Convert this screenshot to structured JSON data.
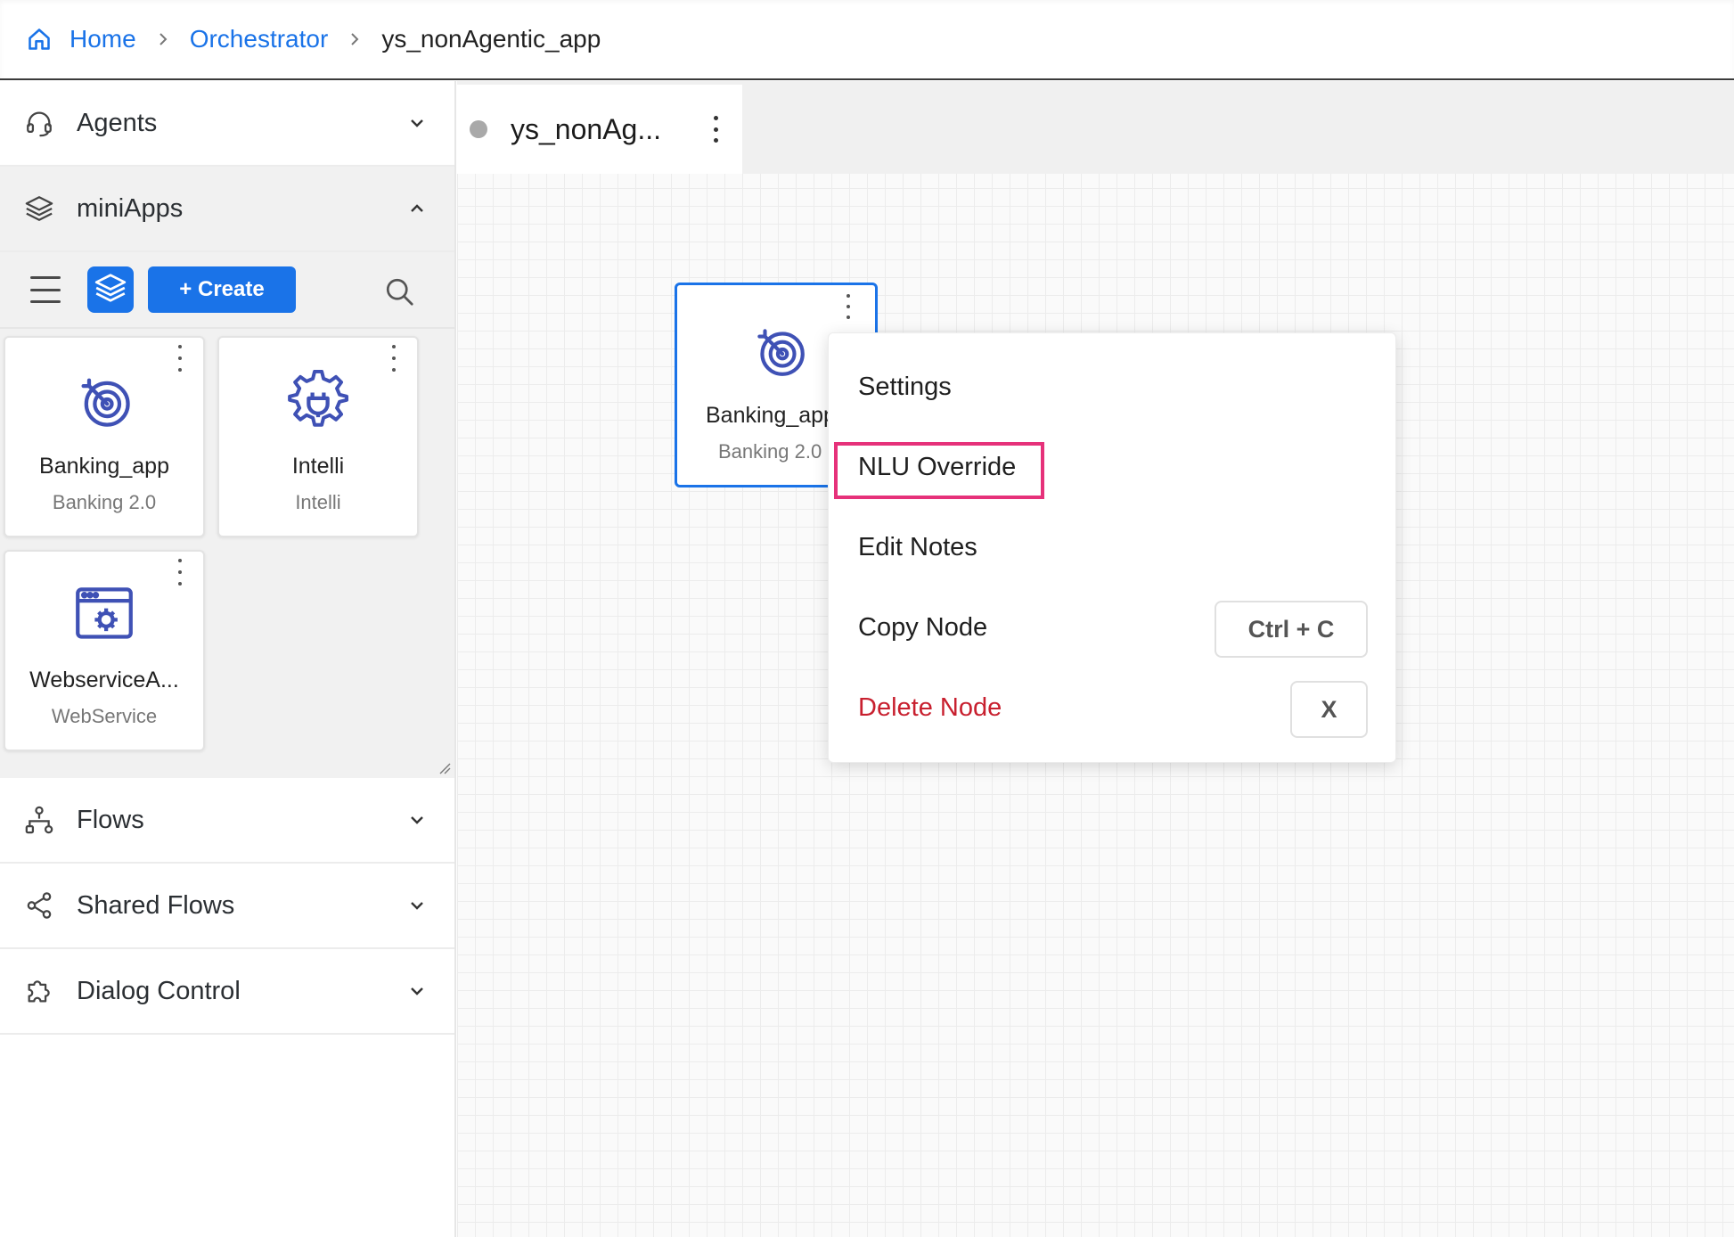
{
  "breadcrumb": {
    "home": "Home",
    "orchestrator": "Orchestrator",
    "current": "ys_nonAgentic_app"
  },
  "sidebar": {
    "agents": "Agents",
    "miniapps": "miniApps",
    "create_label": "+ Create",
    "apps": [
      {
        "title": "Banking_app",
        "subtitle": "Banking 2.0",
        "icon": "target-icon"
      },
      {
        "title": "Intelli",
        "subtitle": "Intelli",
        "icon": "gear-plug-icon"
      },
      {
        "title": "WebserviceA...",
        "subtitle": "WebService",
        "icon": "web-settings-icon"
      }
    ],
    "flows": "Flows",
    "shared_flows": "Shared Flows",
    "dialog_control": "Dialog Control"
  },
  "canvas": {
    "tab_label": "ys_nonAg...",
    "node": {
      "title": "Banking_app",
      "subtitle": "Banking 2.0",
      "icon": "target-icon"
    }
  },
  "context_menu": {
    "settings": "Settings",
    "nlu_override": "NLU Override",
    "edit_notes": "Edit Notes",
    "copy_node": "Copy Node",
    "copy_shortcut": "Ctrl + C",
    "delete_node": "Delete Node",
    "delete_shortcut": "X"
  },
  "colors": {
    "accent": "#1a73e8",
    "icon": "#3f51b5",
    "danger": "#c8202f",
    "highlight": "#e6317a"
  }
}
